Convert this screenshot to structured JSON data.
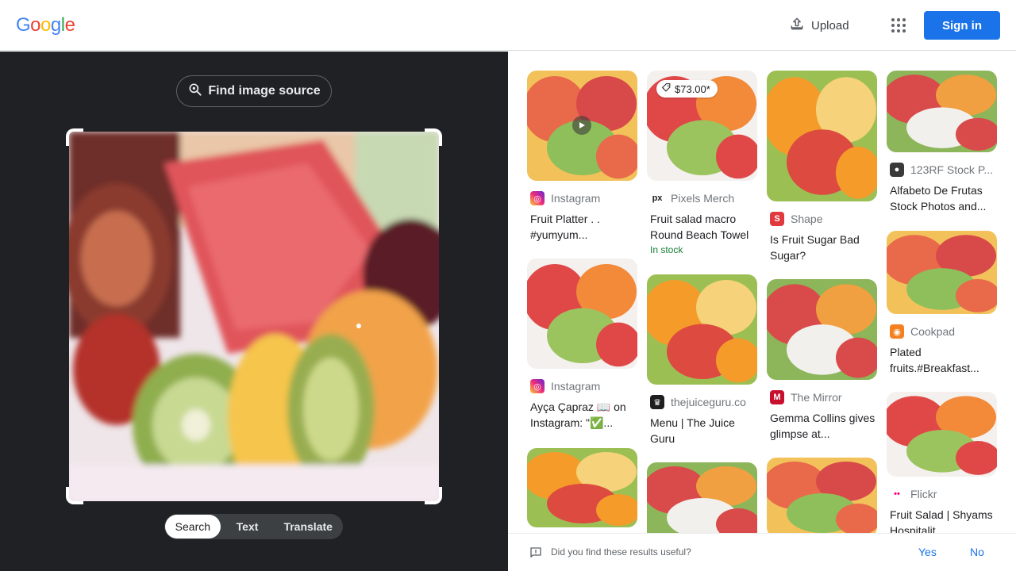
{
  "header": {
    "logo_letters": [
      {
        "ch": "G",
        "color": "#4285f4"
      },
      {
        "ch": "o",
        "color": "#ea4335"
      },
      {
        "ch": "o",
        "color": "#fbbc05"
      },
      {
        "ch": "g",
        "color": "#4285f4"
      },
      {
        "ch": "l",
        "color": "#34a853"
      },
      {
        "ch": "e",
        "color": "#ea4335"
      }
    ],
    "upload_label": "Upload",
    "apps_icon": "apps-grid-icon",
    "signin_label": "Sign in"
  },
  "left": {
    "find_source_label": "Find image source",
    "tabs": [
      {
        "label": "Search",
        "active": true
      },
      {
        "label": "Text",
        "active": false
      },
      {
        "label": "Translate",
        "active": false
      }
    ]
  },
  "results": {
    "columns": [
      [
        {
          "source": "Instagram",
          "icon": "instagram-icon",
          "title": "Fruit Platter . . #yumyum...",
          "price": null,
          "in_stock": null,
          "video": true
        },
        {
          "source": "Instagram",
          "icon": "instagram-icon",
          "title": "Ayça Çapraz 📖 on Instagram: \"✅...",
          "price": null,
          "in_stock": null,
          "video": false
        },
        {
          "source": "",
          "icon": "",
          "title": "",
          "price": null,
          "in_stock": null,
          "video": false
        }
      ],
      [
        {
          "source": "Pixels Merch",
          "icon": "pixels-icon",
          "title": "Fruit salad macro Round Beach Towel",
          "price": "$73.00*",
          "in_stock": "In stock",
          "video": false
        },
        {
          "source": "thejuiceguru.co",
          "icon": "juiceguru-icon",
          "title": "Menu | The Juice Guru",
          "price": null,
          "in_stock": null,
          "video": false
        },
        {
          "source": "",
          "icon": "",
          "title": "",
          "price": null,
          "in_stock": null,
          "video": false
        }
      ],
      [
        {
          "source": "Shape",
          "icon": "shape-icon",
          "title": "Is Fruit Sugar Bad Sugar?",
          "price": null,
          "in_stock": null,
          "video": false
        },
        {
          "source": "The Mirror",
          "icon": "mirror-icon",
          "title": "Gemma Collins gives glimpse at...",
          "price": null,
          "in_stock": null,
          "video": false
        },
        {
          "source": "",
          "icon": "",
          "title": "",
          "price": null,
          "in_stock": null,
          "video": false
        }
      ],
      [
        {
          "source": "123RF Stock P...",
          "icon": "123rf-icon",
          "title": "Alfabeto De Frutas Stock Photos and...",
          "price": null,
          "in_stock": null,
          "video": false
        },
        {
          "source": "Cookpad",
          "icon": "cookpad-icon",
          "title": "Plated fruits.#Breakfast...",
          "price": null,
          "in_stock": null,
          "video": false
        },
        {
          "source": "Flickr",
          "icon": "flickr-icon",
          "title": "Fruit Salad | Shyams Hospitalit...",
          "price": null,
          "in_stock": null,
          "video": false
        }
      ]
    ]
  },
  "feedback": {
    "question": "Did you find these results useful?",
    "yes_label": "Yes",
    "no_label": "No"
  },
  "colors": {
    "accent": "#1a73e8",
    "dark_pane": "#202124",
    "in_stock": "#188038"
  }
}
